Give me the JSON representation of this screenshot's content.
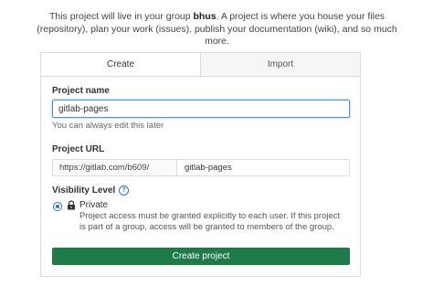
{
  "intro": {
    "before": "This project will live in your group ",
    "group": "bhus",
    "after": ". A project is where you house your files (repository), plan your work (issues), publish your documentation (wiki), and so much more."
  },
  "tabs": [
    {
      "label": "Create",
      "active": true
    },
    {
      "label": "Import",
      "active": false
    }
  ],
  "project_name": {
    "label": "Project name",
    "value": "gitlab-pages",
    "help": "You can always edit this later"
  },
  "project_url": {
    "label": "Project URL",
    "prefix": "https://gitlab.com/b609/",
    "path": "gitlab-pages"
  },
  "visibility": {
    "label": "Visibility Level",
    "help_icon": "question-circle-icon",
    "option_icon": "lock-icon",
    "option_title": "Private",
    "option_description": "Project access must be granted explicitly to each user. If this project is part of a group, access will be granted to members of the group.",
    "selected": true
  },
  "submit": {
    "label": "Create project"
  },
  "colors": {
    "accent": "#1f78d1",
    "primary_button": "#1e7a47",
    "focus_border": "#4a90d9"
  }
}
